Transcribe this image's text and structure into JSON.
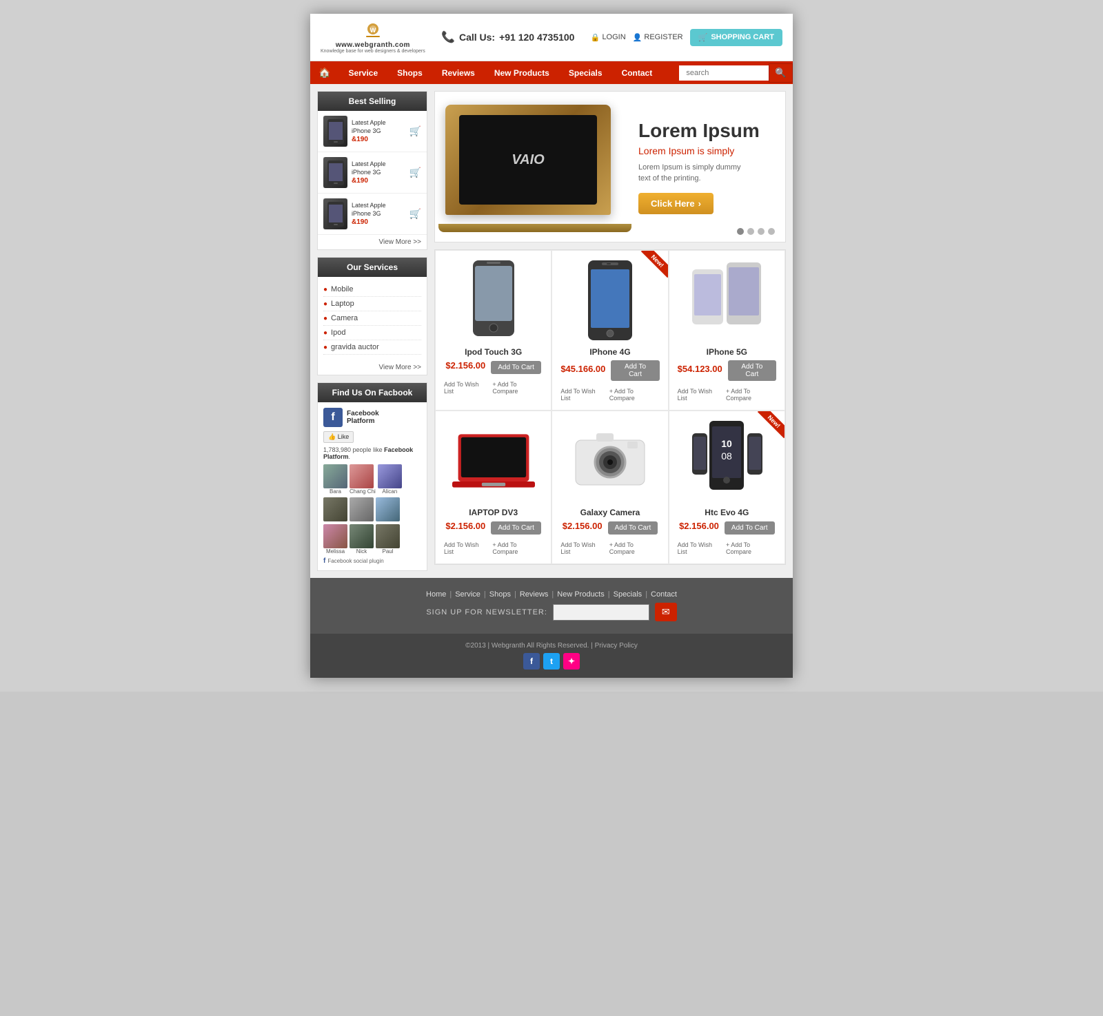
{
  "site": {
    "logo_url": "www.webgranth.com",
    "logo_sub": "Knowledge base for web designers & developers",
    "call_label": "Call Us:",
    "call_number": "+91 120 4735100",
    "login_label": "LOGIN",
    "register_label": "REGISTER",
    "cart_label": "SHOPPING CART"
  },
  "nav": {
    "home_icon": "🏠",
    "items": [
      {
        "label": "Service"
      },
      {
        "label": "Shops"
      },
      {
        "label": "Reviews"
      },
      {
        "label": "New Products"
      },
      {
        "label": "Specials"
      },
      {
        "label": "Contact"
      }
    ],
    "search_placeholder": "search"
  },
  "sidebar": {
    "best_selling_title": "Best Selling",
    "items": [
      {
        "name": "Latest Apple iPhone 3G",
        "price": "&190"
      },
      {
        "name": "Latest Apple iPhone 3G",
        "price": "&190"
      },
      {
        "name": "Latest Apple iPhone 3G",
        "price": "&190"
      }
    ],
    "view_more": "View More >>",
    "services_title": "Our Services",
    "services": [
      {
        "label": "Mobile"
      },
      {
        "label": "Laptop"
      },
      {
        "label": "Camera"
      },
      {
        "label": "Ipod"
      },
      {
        "label": "gravida auctor"
      }
    ],
    "services_view_more": "View More >>",
    "facebook_title": "Find Us On Facbook",
    "fb_platform": "Facebook\nPlatform",
    "fb_like": "👍 Like",
    "fb_people": "1,783,980 people like",
    "fb_brand": "Facebook Platform",
    "fb_users": [
      "Bara",
      "Chang Chi",
      "Alican",
      "",
      "",
      "Melissa",
      "Nick",
      "Paul"
    ],
    "fb_plugin": "Facebook social plugin"
  },
  "banner": {
    "title": "Lorem Ipsum",
    "subtitle": "Lorem Ipsum is simply",
    "desc": "Lorem Ipsum is simply dummy\ntext of the printing.",
    "btn_label": "Click Here",
    "laptop_logo": "VAIO"
  },
  "products": [
    {
      "name": "Ipod Touch 3G",
      "price": "$2.156.00",
      "add_cart": "Add To Cart",
      "wish": "Add To Wish List",
      "compare": "+ Add To Compare",
      "is_new": false,
      "type": "ipod"
    },
    {
      "name": "IPhone 4G",
      "price": "$45.166.00",
      "add_cart": "Add To Cart",
      "wish": "Add To Wish List",
      "compare": "+ Add To Compare",
      "is_new": true,
      "type": "phone"
    },
    {
      "name": "IPhone 5G",
      "price": "$54.123.00",
      "add_cart": "Add To Cart",
      "wish": "Add To Wish List",
      "compare": "+ Add To Compare",
      "is_new": false,
      "type": "phone5"
    },
    {
      "name": "IAPTOP DV3",
      "price": "$2.156.00",
      "add_cart": "Add To Cart",
      "wish": "Add To Wish List",
      "compare": "+ Add To Compare",
      "is_new": false,
      "type": "laptop"
    },
    {
      "name": "Galaxy Camera",
      "price": "$2.156.00",
      "add_cart": "Add To Cart",
      "wish": "Add To Wish List",
      "compare": "+ Add To Compare",
      "is_new": false,
      "type": "camera"
    },
    {
      "name": "Htc Evo 4G",
      "price": "$2.156.00",
      "add_cart": "Add To Cart",
      "wish": "Add To Wish List",
      "compare": "+ Add To Compare",
      "is_new": true,
      "type": "htc"
    }
  ],
  "footer": {
    "links": [
      "Home",
      "Service",
      "Shops",
      "Reviews",
      "New Products",
      "Specials",
      "Contact"
    ],
    "newsletter_label": "SIGN UP FOR NEWSLETTER:",
    "newsletter_placeholder": "",
    "copyright": "©2013 | Webgranth All Rights Reserved. | Privacy Policy"
  }
}
